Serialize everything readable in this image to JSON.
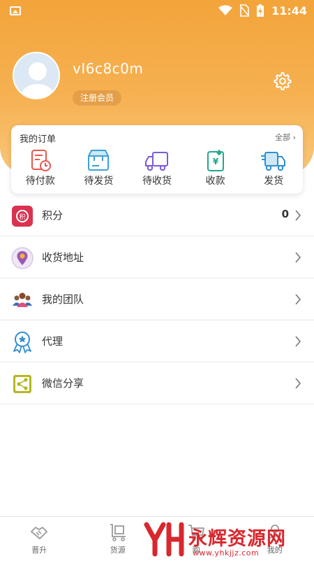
{
  "status_bar": {
    "time": "11:44"
  },
  "profile": {
    "username": "vI6c8c0m",
    "badge": "注册会员"
  },
  "orders": {
    "title": "我的订单",
    "all_label": "全部",
    "items": [
      {
        "label": "待付款",
        "icon": "pending-payment-icon"
      },
      {
        "label": "待发货",
        "icon": "pending-shipment-icon"
      },
      {
        "label": "待收货",
        "icon": "pending-receipt-icon"
      },
      {
        "label": "收款",
        "icon": "receive-payment-icon"
      },
      {
        "label": "发货",
        "icon": "ship-icon"
      }
    ]
  },
  "menu": [
    {
      "label": "积分",
      "value": "0",
      "icon": "points-icon"
    },
    {
      "label": "收货地址",
      "value": "",
      "icon": "location-icon"
    },
    {
      "label": "我的团队",
      "value": "",
      "icon": "team-icon"
    },
    {
      "label": "代理",
      "value": "",
      "icon": "agent-badge-icon"
    },
    {
      "label": "微信分享",
      "value": "",
      "icon": "share-icon"
    }
  ],
  "bottom_nav": [
    {
      "label": "晋升",
      "icon": "handshake-icon"
    },
    {
      "label": "货源",
      "icon": "goods-source-icon"
    },
    {
      "label": "购",
      "icon": "cart-icon"
    },
    {
      "label": "我的",
      "icon": "user-icon"
    }
  ],
  "watermark": {
    "text": "永辉资源网",
    "url": "www.yhkjjz.com"
  },
  "colors": {
    "header_orange": "#f3a43a",
    "watermark_red": "#d9272e"
  }
}
